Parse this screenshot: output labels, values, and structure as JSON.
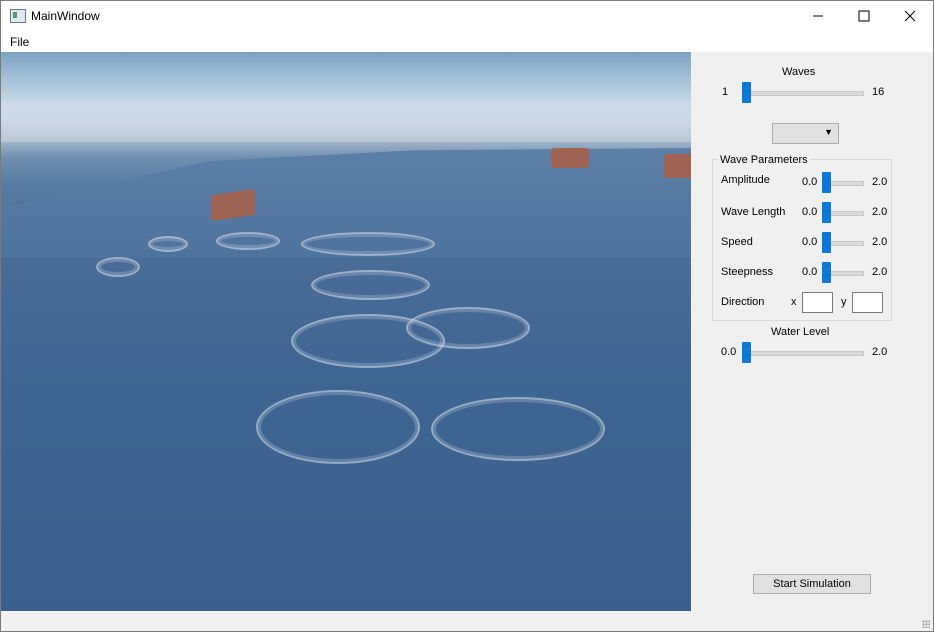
{
  "window": {
    "title": "MainWindow",
    "icon": "app-window-icon"
  },
  "title_buttons": {
    "minimize": "—",
    "maximize": "☐",
    "close": "✕"
  },
  "menu": {
    "items": [
      "File"
    ]
  },
  "panel": {
    "waves": {
      "label": "Waves",
      "min": "1",
      "max": "16",
      "value": 1
    },
    "wave_selector": {
      "selected": ""
    },
    "wave_parameters": {
      "title": "Wave Parameters",
      "rows": [
        {
          "label": "Amplitude",
          "min": "0.0",
          "max": "2.0",
          "value": 0.0
        },
        {
          "label": "Wave Length",
          "min": "0.0",
          "max": "2.0",
          "value": 0.0
        },
        {
          "label": "Speed",
          "min": "0.0",
          "max": "2.0",
          "value": 0.0
        },
        {
          "label": "Steepness",
          "min": "0.0",
          "max": "2.0",
          "value": 0.0
        }
      ],
      "direction": {
        "label": "Direction",
        "x_label": "x",
        "y_label": "y",
        "x_value": "",
        "y_value": ""
      }
    },
    "water_level": {
      "label": "Water Level",
      "min": "0.0",
      "max": "2.0",
      "value": 0.0
    },
    "start_button": "Start Simulation"
  },
  "colors": {
    "accent": "#0a78d7",
    "water": "#3f6592",
    "buoy": "#a5614a"
  }
}
